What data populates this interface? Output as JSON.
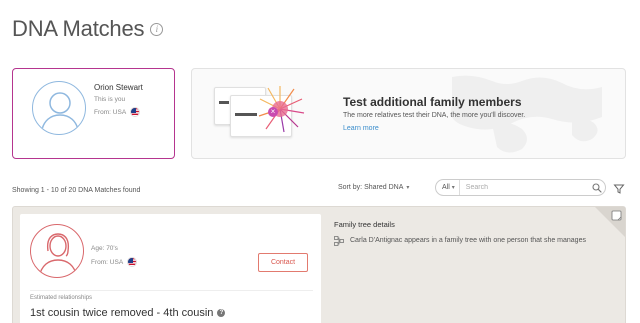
{
  "header": {
    "title": "DNA Matches",
    "info_icon": "info-icon"
  },
  "profile": {
    "name": "Orion Stewart",
    "subtitle": "This is you",
    "from_label": "From:",
    "from_value": "USA",
    "flag_icon": "us-flag-icon",
    "border_color": "#b5358f"
  },
  "promo": {
    "title": "Test additional family members",
    "description": "The more relatives test their DNA, the more you'll discover.",
    "link": "Learn more"
  },
  "results": {
    "showing": "Showing 1 - 10 of 20 DNA Matches found",
    "sort_label": "Sort by: Shared DNA",
    "filter_select": "All",
    "search_placeholder": "Search"
  },
  "match": {
    "age_label": "Age:",
    "age_value": "70's",
    "from_label": "From:",
    "from_value": "USA",
    "contact_label": "Contact",
    "estimated_label": "Estimated relationships",
    "estimated_value": "1st cousin twice removed - 4th cousin",
    "tree_title": "Family tree details",
    "tree_text": "Carla D'Antignac appears in a family tree with one person that she manages"
  },
  "colors": {
    "accent_magenta": "#b5358f",
    "contact_red": "#d9564d",
    "link_blue": "#3a8dcc"
  }
}
